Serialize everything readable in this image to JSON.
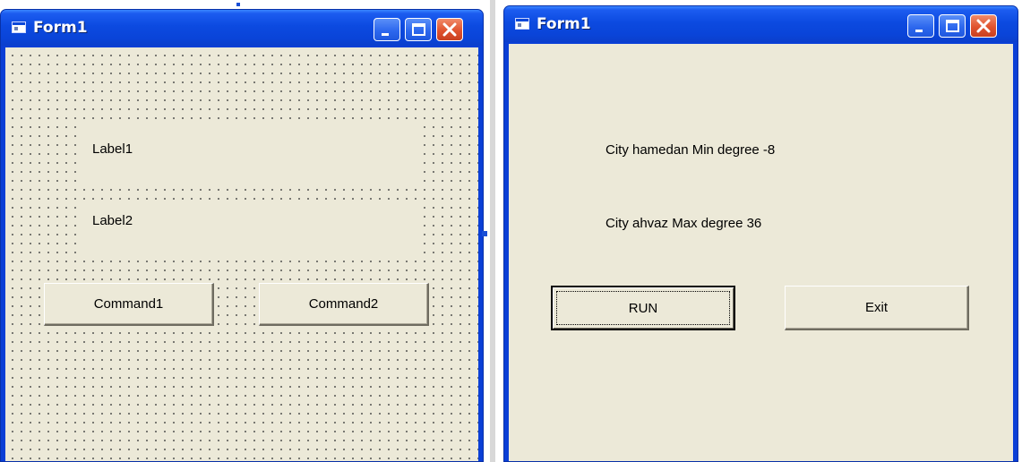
{
  "design_window": {
    "title": "Form1",
    "label1": "Label1",
    "label2": "Label2",
    "command1": "Command1",
    "command2": "Command2"
  },
  "run_window": {
    "title": "Form1",
    "label1": "City hamedan  Min degree -8",
    "label2": "City ahvaz  Max degree 36",
    "run_button": "RUN",
    "exit_button": "Exit"
  },
  "colors": {
    "titlebar": "#0a44d8",
    "client_background": "#ece9d8",
    "close_button": "#e0532e"
  },
  "icons": [
    "form-icon",
    "minimize-icon",
    "maximize-icon",
    "close-icon"
  ]
}
